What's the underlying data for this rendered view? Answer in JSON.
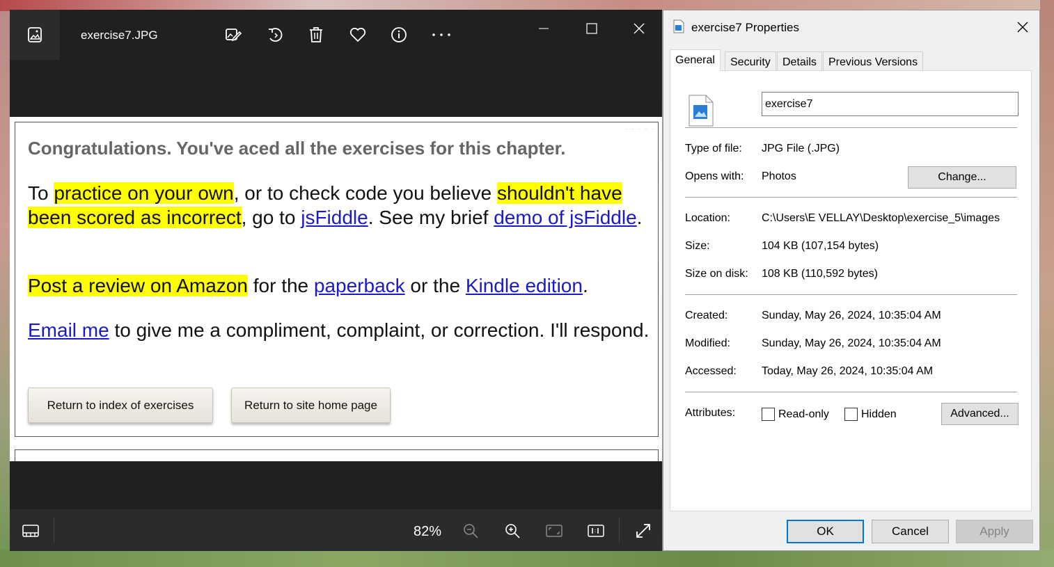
{
  "photos": {
    "title": "exercise7.JPG",
    "toolbar_icons": [
      "edit-image-icon",
      "rotate-icon",
      "delete-icon",
      "favorite-icon",
      "info-icon",
      "more-icon"
    ],
    "zoom": "82%",
    "document": {
      "heading": "Congratulations. You've aced all the exercises for this chapter.",
      "p1": {
        "t1": "To ",
        "hl1": "practice on your own",
        "t2": ", or to check code you believe ",
        "hl2": "shouldn't have been scored as incorrect",
        "t3": ", go to ",
        "link1": "jsFiddle",
        "t4": ". See my brief ",
        "link2": "demo of jsFiddle",
        "t5": "."
      },
      "p2": {
        "hl1": "Post a review on Amazon",
        "t1": " for the ",
        "link1": "paperback",
        "t2": " or the ",
        "link2": "Kindle edition",
        "t3": "."
      },
      "p3": {
        "link1": "Email me",
        "t1": " to give me a compliment, complaint, or correction. I'll respond."
      },
      "buttons": {
        "index": "Return to index of exercises",
        "home": "Return to site home page"
      }
    }
  },
  "properties": {
    "title": "exercise7 Properties",
    "tabs": [
      "General",
      "Security",
      "Details",
      "Previous Versions"
    ],
    "file_name": "exercise7",
    "rows": {
      "type_label": "Type of file:",
      "type_value": "JPG File (.JPG)",
      "opens_label": "Opens with:",
      "opens_value": "Photos",
      "change_button": "Change...",
      "location_label": "Location:",
      "location_value": "C:\\Users\\E VELLAY\\Desktop\\exercise_5\\images",
      "size_label": "Size:",
      "size_value": "104 KB (107,154 bytes)",
      "size_disk_label": "Size on disk:",
      "size_disk_value": "108 KB (110,592 bytes)",
      "created_label": "Created:",
      "created_value": "Sunday, May 26, 2024, 10:35:04 AM",
      "modified_label": "Modified:",
      "modified_value": "Sunday, May 26, 2024, 10:35:04 AM",
      "accessed_label": "Accessed:",
      "accessed_value": "Today, May 26, 2024, 10:35:04 AM",
      "attributes_label": "Attributes:",
      "readonly_label": "Read-only",
      "hidden_label": "Hidden",
      "advanced_button": "Advanced..."
    },
    "buttons": {
      "ok": "OK",
      "cancel": "Cancel",
      "apply": "Apply"
    }
  },
  "colors": {
    "highlight": "#ffff00",
    "link": "#1a1acc",
    "accent": "#0078d7"
  }
}
